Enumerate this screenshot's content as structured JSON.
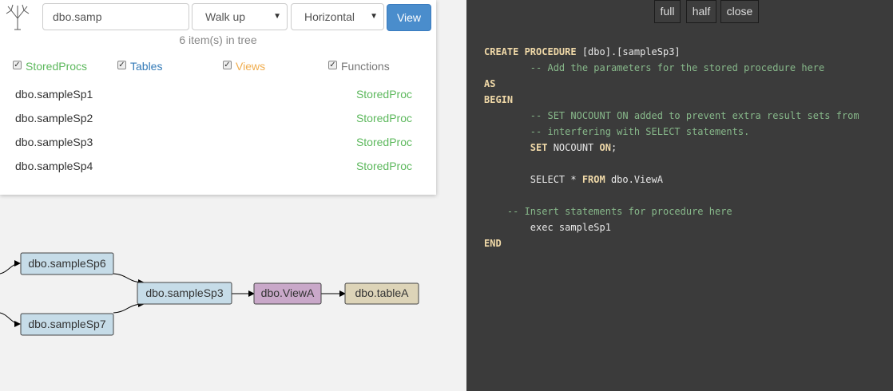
{
  "search": {
    "value": "dbo.samp"
  },
  "walk_select": {
    "value": "Walk up"
  },
  "direction_select": {
    "value": "Horizontal"
  },
  "view_button": {
    "label": "View"
  },
  "tree_count": "6 item(s) in tree",
  "filters": [
    {
      "label": "StoredProcs",
      "checked": true
    },
    {
      "label": "Tables",
      "checked": true
    },
    {
      "label": "Views",
      "checked": true
    },
    {
      "label": "Functions",
      "checked": true
    }
  ],
  "results": [
    {
      "name": "dbo.sampleSp1",
      "type": "StoredProc"
    },
    {
      "name": "dbo.sampleSp2",
      "type": "StoredProc"
    },
    {
      "name": "dbo.sampleSp3",
      "type": "StoredProc"
    },
    {
      "name": "dbo.sampleSp4",
      "type": "StoredProc"
    }
  ],
  "graph": {
    "nodes": [
      {
        "label": "dbo.sampleSp6",
        "color": "#c6dce8"
      },
      {
        "label": "dbo.sampleSp7",
        "color": "#c6dce8"
      },
      {
        "label": "dbo.sampleSp3",
        "color": "#c6dce8"
      },
      {
        "label": "dbo.ViewA",
        "color": "#c9a8c9"
      },
      {
        "label": "dbo.tableA",
        "color": "#ddd4b8"
      }
    ]
  },
  "code_panel": {
    "buttons": {
      "full": "full",
      "half": "half",
      "close": "close"
    },
    "lines": [
      {
        "parts": [
          [
            "kw",
            "CREATE PROCEDURE"
          ],
          [
            "tx",
            " [dbo].[sampleSp3]"
          ]
        ]
      },
      {
        "parts": [
          [
            "cm",
            "        -- Add the parameters for the stored procedure here"
          ]
        ]
      },
      {
        "parts": [
          [
            "kw",
            "AS"
          ]
        ]
      },
      {
        "parts": [
          [
            "kw",
            "BEGIN"
          ]
        ]
      },
      {
        "parts": [
          [
            "cm",
            "        -- SET NOCOUNT ON added to prevent extra result sets from"
          ]
        ]
      },
      {
        "parts": [
          [
            "cm",
            "        -- interfering with SELECT statements."
          ]
        ]
      },
      {
        "parts": [
          [
            "tx",
            "        "
          ],
          [
            "kw",
            "SET"
          ],
          [
            "tx",
            " NOCOUNT "
          ],
          [
            "kw",
            "ON"
          ],
          [
            "tx",
            ";"
          ]
        ]
      },
      {
        "parts": [
          [
            "tx",
            ""
          ]
        ]
      },
      {
        "parts": [
          [
            "tx",
            "        SELECT * "
          ],
          [
            "kw",
            "FROM"
          ],
          [
            "tx",
            " dbo.ViewA"
          ]
        ]
      },
      {
        "parts": [
          [
            "tx",
            ""
          ]
        ]
      },
      {
        "parts": [
          [
            "cm",
            "    -- Insert statements for procedure here"
          ]
        ]
      },
      {
        "parts": [
          [
            "tx",
            "        exec sampleSp1"
          ]
        ]
      },
      {
        "parts": [
          [
            "kw",
            "END"
          ]
        ]
      }
    ]
  }
}
